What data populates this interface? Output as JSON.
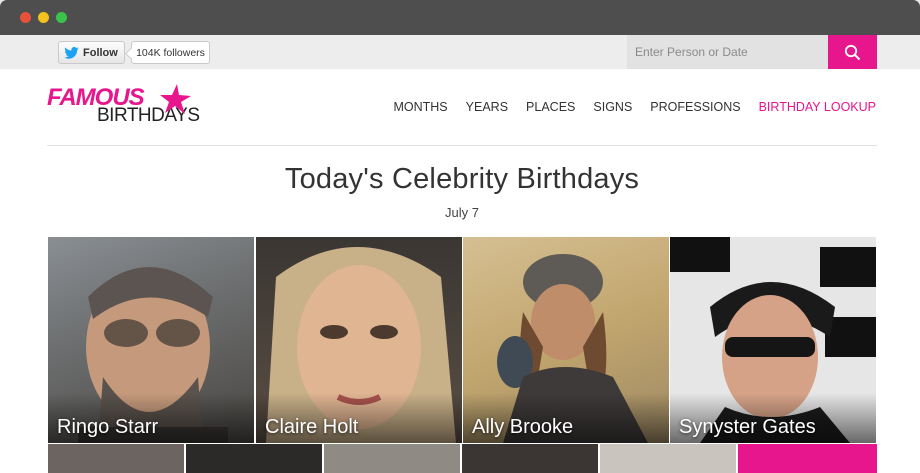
{
  "twitter": {
    "follow_label": "Follow",
    "followers": "104K followers"
  },
  "search": {
    "placeholder": "Enter Person or Date"
  },
  "logo": {
    "word1": "FAMOUS",
    "word2": "BIRTHDAYS"
  },
  "nav": [
    {
      "label": "MONTHS"
    },
    {
      "label": "YEARS"
    },
    {
      "label": "PLACES"
    },
    {
      "label": "SIGNS"
    },
    {
      "label": "PROFESSIONS"
    },
    {
      "label": "BIRTHDAY LOOKUP"
    }
  ],
  "heading": {
    "title": "Today's Celebrity Birthdays",
    "date": "July 7"
  },
  "celebrities": [
    {
      "name": "Ringo Starr"
    },
    {
      "name": "Claire Holt"
    },
    {
      "name": "Ally Brooke"
    },
    {
      "name": "Synyster Gates"
    }
  ],
  "colors": {
    "accent": "#e8168c",
    "chrome": "#4e4e4e"
  }
}
